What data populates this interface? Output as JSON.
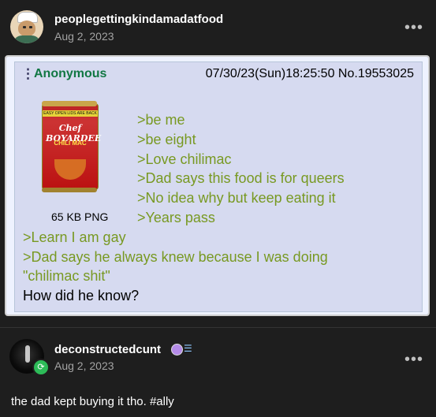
{
  "post1": {
    "username": "peoplegettingkindamadatfood",
    "date": "Aug 2, 2023",
    "more": "•••"
  },
  "greentext": {
    "name": "Anonymous",
    "meta": "07/30/23(Sun)18:25:50 No.19553025",
    "image_brand": "Chef BOYARDEE",
    "image_label": "CHILI MAC",
    "image_band": "EASY OPEN LIDS ARE BACK",
    "filesize": "65 KB PNG",
    "lines": [
      ">be me",
      ">be eight",
      ">Love chilimac",
      ">Dad says this food is for queers",
      ">No idea why but keep eating it",
      ">Years pass",
      ">Learn I am gay",
      ">Dad says he always knew because I was doing",
      "\"chilimac shit\""
    ],
    "final": "How did he know?"
  },
  "post2": {
    "username": "deconstructedcunt",
    "date": "Aug 2, 2023",
    "more": "•••",
    "reply": "the dad kept buying it tho. #ally"
  },
  "colors": {
    "greentext": "#789922",
    "anon_name": "#117743",
    "card_bg": "#d6daf0",
    "page_bg": "#1e1e1e"
  }
}
